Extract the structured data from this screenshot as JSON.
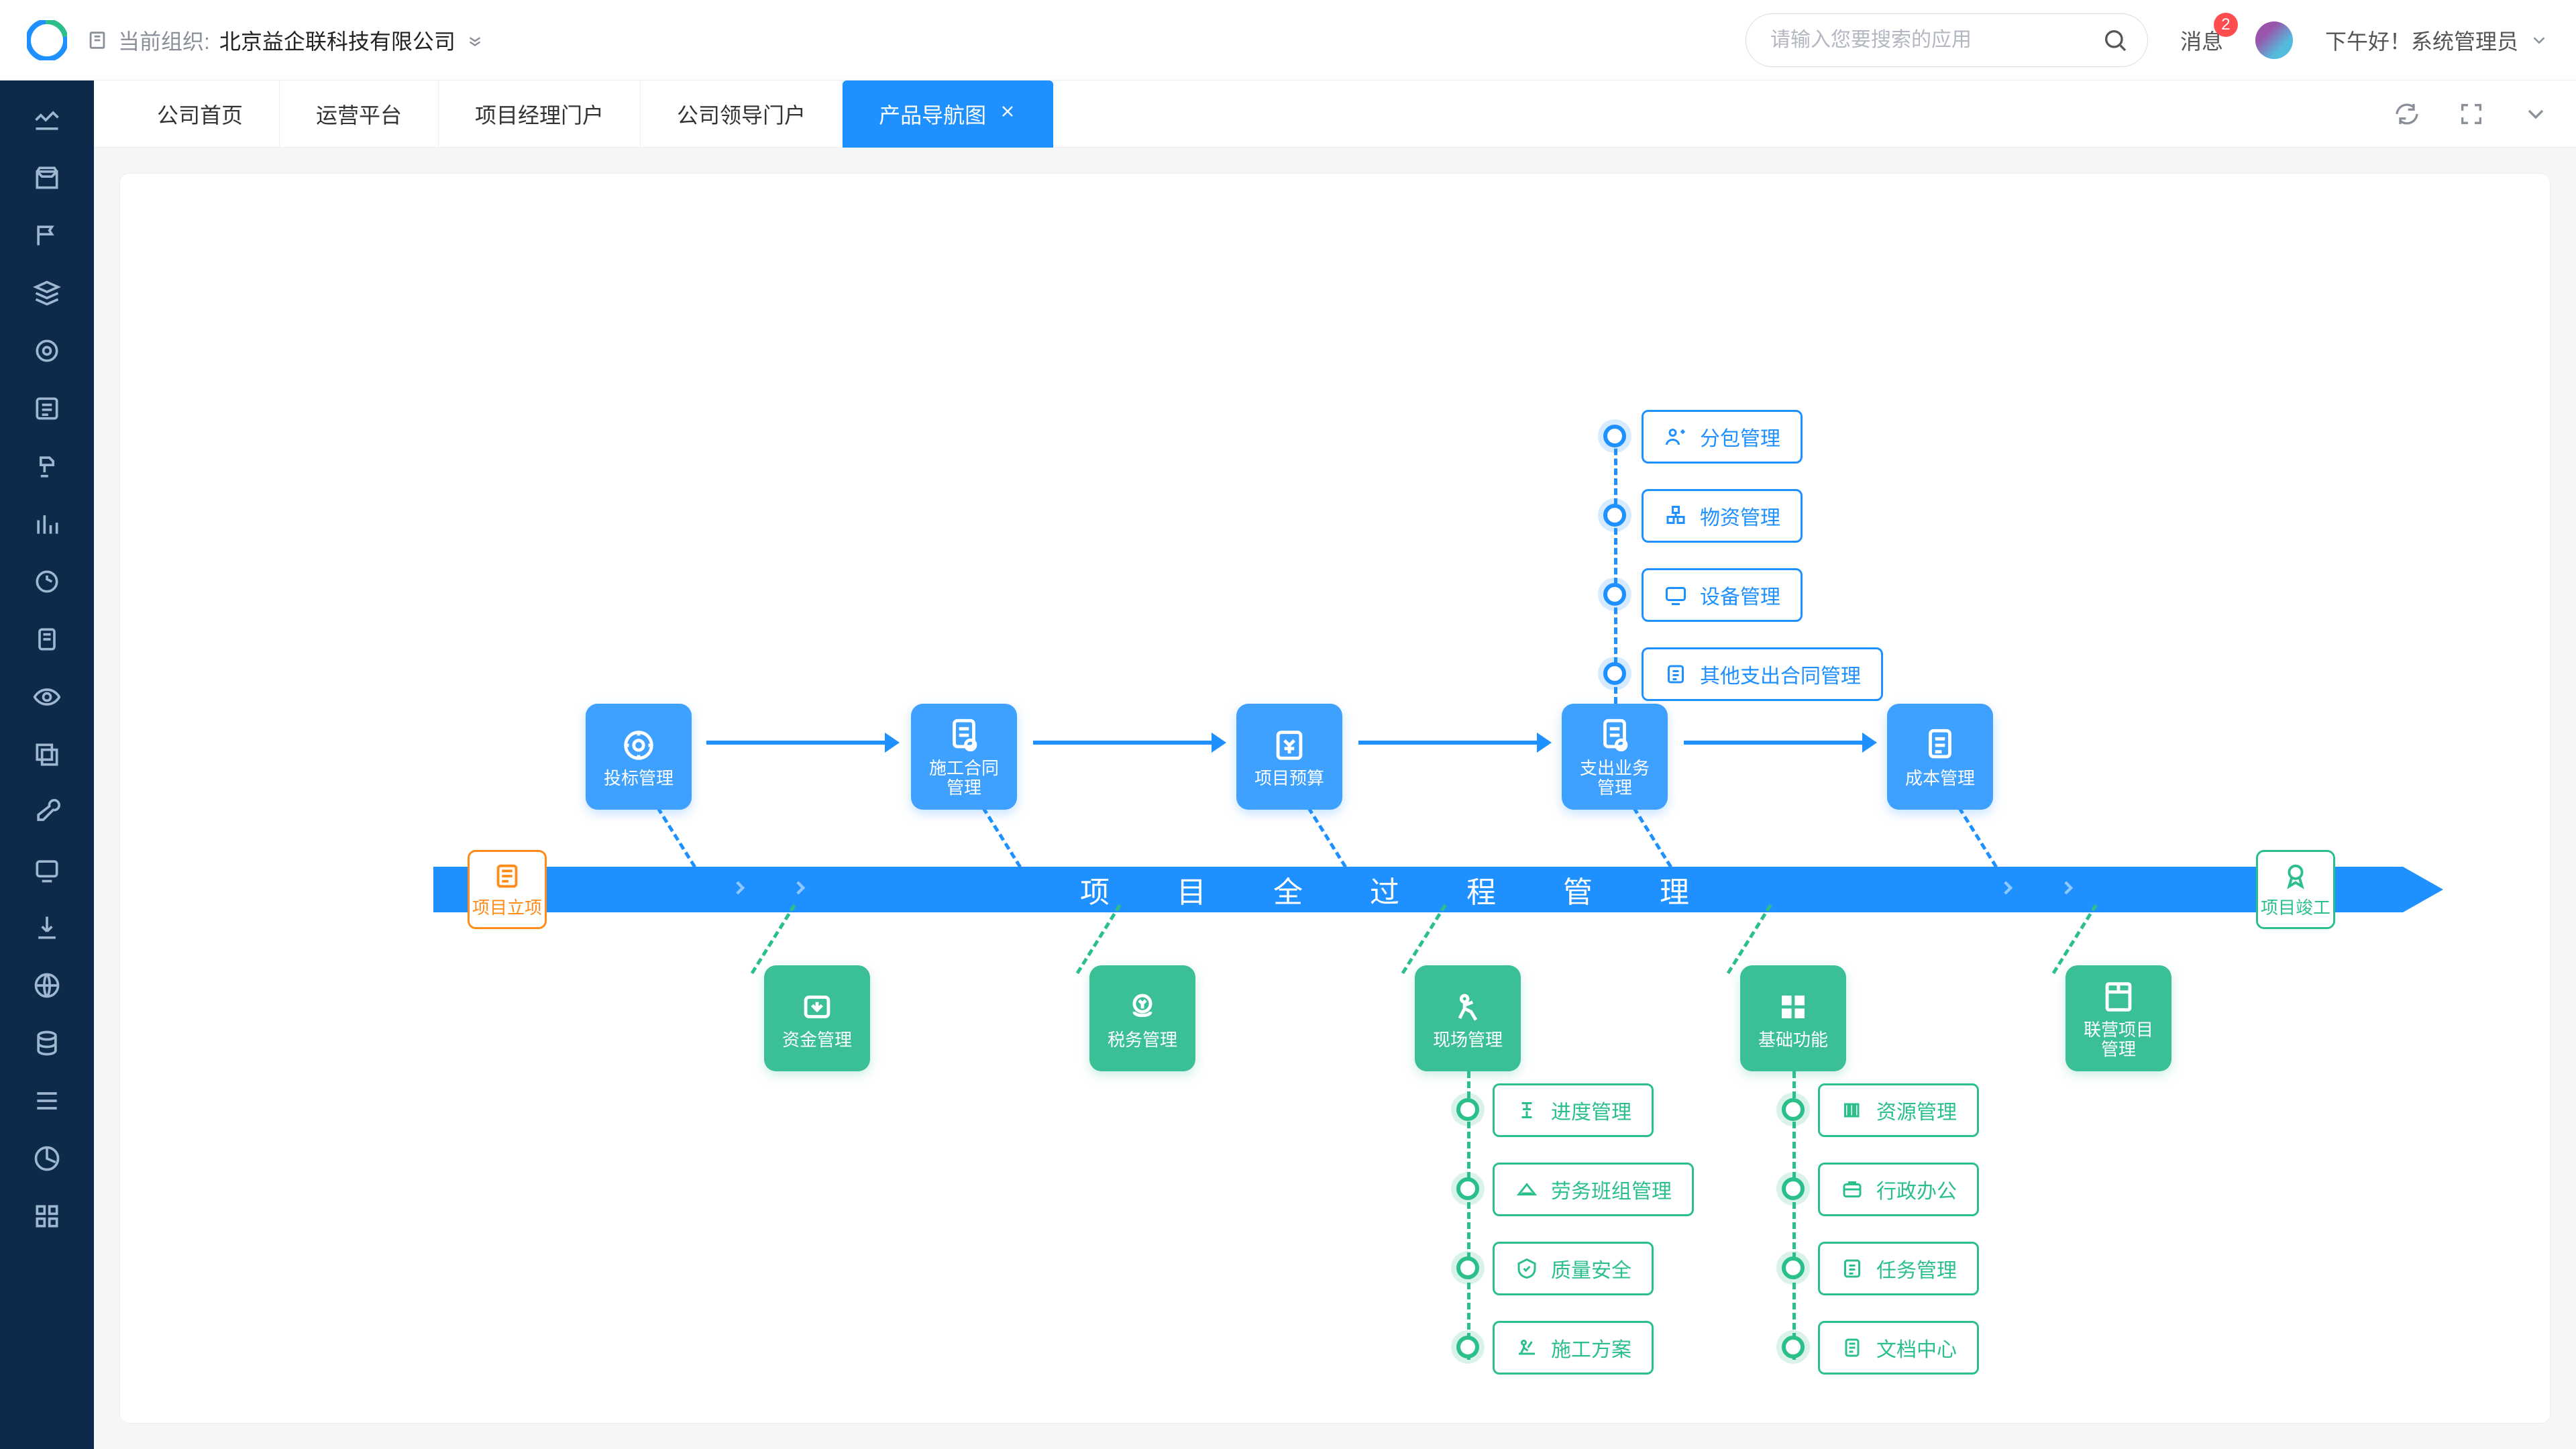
{
  "header": {
    "org_label": "当前组织:",
    "org_name": "北京益企联科技有限公司",
    "search_placeholder": "请输入您要搜索的应用",
    "notif_label": "消息",
    "notif_badge": "2",
    "greeting": "下午好！系统管理员"
  },
  "tabs": [
    {
      "label": "公司首页",
      "active": false
    },
    {
      "label": "运营平台",
      "active": false
    },
    {
      "label": "项目经理门户",
      "active": false
    },
    {
      "label": "公司领导门户",
      "active": false
    },
    {
      "label": "产品导航图",
      "active": true
    }
  ],
  "axis_label": "项目全过程管理",
  "markers": {
    "start": "项目立项",
    "end": "项目竣工"
  },
  "top_nodes": [
    {
      "label": "投标管理"
    },
    {
      "label": "施工合同\n管理"
    },
    {
      "label": "项目预算"
    },
    {
      "label": "支出业务\n管理"
    },
    {
      "label": "成本管理"
    }
  ],
  "top_pills": [
    {
      "label": "分包管理"
    },
    {
      "label": "物资管理"
    },
    {
      "label": "设备管理"
    },
    {
      "label": "其他支出合同管理"
    }
  ],
  "bottom_nodes": [
    {
      "label": "资金管理"
    },
    {
      "label": "税务管理"
    },
    {
      "label": "现场管理"
    },
    {
      "label": "基础功能"
    },
    {
      "label": "联营项目\n管理"
    }
  ],
  "site_pills": [
    {
      "label": "进度管理"
    },
    {
      "label": "劳务班组管理"
    },
    {
      "label": "质量安全"
    },
    {
      "label": "施工方案"
    }
  ],
  "base_pills": [
    {
      "label": "资源管理"
    },
    {
      "label": "行政办公"
    },
    {
      "label": "任务管理"
    },
    {
      "label": "文档中心"
    }
  ],
  "sidebar_icons": [
    "dashboard",
    "store",
    "flag",
    "layers",
    "target",
    "form",
    "stamp",
    "chart-bar",
    "money",
    "receipt",
    "eye",
    "copy",
    "wrench",
    "media",
    "download",
    "globe",
    "db",
    "list",
    "pie",
    "grid"
  ]
}
